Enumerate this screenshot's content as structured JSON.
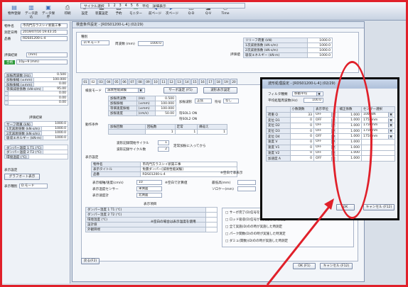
{
  "ribbon": {
    "buttons": [
      {
        "label": "物件登録",
        "icon": "folder-icon",
        "color": "#3a6db8"
      },
      {
        "label": "データ読込",
        "icon": "open-file-icon",
        "color": "#3a6db8"
      },
      {
        "label": "データ保存",
        "icon": "save-icon",
        "color": "#3a6db8"
      },
      {
        "label": "印刷",
        "icon": "print-icon",
        "color": "#555555"
      },
      {
        "label": "設定",
        "icon": "settings-icon",
        "color": "#555555"
      },
      {
        "label": "装置設定",
        "icon": "device-icon",
        "color": "#555555"
      },
      {
        "label": "予約",
        "icon": "calendar-icon",
        "color": "#555555"
      },
      {
        "label": "モニター",
        "icon": "monitor-icon",
        "color": "#2b8a3e"
      },
      {
        "label": "前ページ",
        "icon": "back-arrow-icon",
        "color": "#2456b0"
      },
      {
        "label": "次ページ",
        "icon": "forward-arrow-icon",
        "color": "#2456b0"
      },
      {
        "label": "Q-D",
        "icon": "qd-icon",
        "color": "#555555"
      },
      {
        "label": "Q-V",
        "icon": "qv-icon",
        "color": "#555555"
      },
      {
        "label": "Time",
        "icon": "time-icon",
        "color": "#555555"
      }
    ],
    "toolbar": [
      "サイクル選択",
      "1",
      "2",
      "3",
      "4",
      "5",
      "6",
      "平均",
      "詳細表示"
    ]
  },
  "left": {
    "rows": [
      {
        "label": "物件名",
        "value": "市内門方ラスシイ新築工事"
      },
      {
        "label": "測定日時",
        "value": "2019/07/16 19:43:35"
      },
      {
        "label": "品番",
        "value": "RDS01200-L-4"
      }
    ],
    "judge_label": "評価結果",
    "judge_badge": "合格",
    "spec_rows": [
      {
        "label": "評価結果",
        "value": "(mm)",
        "extra": ""
      },
      {
        "label": "加振状態",
        "value": "10μ~9 (mm)",
        "extra": ""
      }
    ],
    "table1": [
      [
        "加振周波数 (Hz)",
        "0.500"
      ],
      [
        "加振振幅 (±mm)",
        "100.000"
      ],
      [
        "加振振幅 (±mm)",
        "0.00"
      ],
      [
        "等価減衰係数 (kN·s/m)",
        "95.00"
      ],
      [
        "",
        "0.00"
      ],
      [
        "",
        "0.00"
      ],
      [
        "",
        "0.00"
      ]
    ],
    "section2_title": "評価結果",
    "table2": [
      [
        "サーフ荷重 (kN)",
        "1000.0"
      ],
      [
        "1次減衰係数 (kN·s/m)",
        "1000.0"
      ],
      [
        "2次減衰係数 (kN·s/m)",
        "1000.0"
      ],
      [
        "吸収エネルギー (kN·m)",
        "1000.0"
      ]
    ],
    "table3": [
      [
        "ダンパー温度 1 T1 (℃)",
        ""
      ],
      [
        "ダンパー温度 2 T2 (℃)",
        ""
      ],
      [
        "環境温度 (℃)",
        ""
      ]
    ],
    "mode_label": "表示設定",
    "mode_button": "グラフオート表示",
    "speed_label": "表示種別",
    "speed_value": "D.モード"
  },
  "main": {
    "title": "検査条件設定 - [RDS01200-L-4] (02/29)",
    "type_label": "種別",
    "type_value": "Ｄ/Ｋモード",
    "freq_label": "周波数 (mm)",
    "freq_value": "1000.0",
    "eval_label": "評価値",
    "eval_rows": [
      [
        "リリーフ荷重 (kN)",
        "1000.0"
      ],
      [
        "1次減衰係数 (kN·s/m)",
        "1000.0"
      ],
      [
        "2次減衰係数 (kN·s/m)",
        "1000.0"
      ],
      [
        "吸収エネルギー (kN·m)",
        "1000.0"
      ]
    ],
    "tabs": [
      "01",
      "02",
      "03",
      "04",
      "05",
      "06",
      "07",
      "08",
      "09",
      "10",
      "11",
      "12",
      "13",
      "14",
      "15",
      "16",
      "17",
      "18",
      "19",
      "20"
    ],
    "mode_label": "検査モード",
    "mode_value": "減衰性能試験",
    "servo_btn": "サーボ設定 (F5)",
    "sensor_btn": "波形表示設定",
    "cond_label": "動作条件",
    "cond_rows": [
      [
        "加振周波数",
        "(Hz)",
        "0.500"
      ],
      [
        "加振振幅",
        "(±mm)",
        "100.000"
      ],
      [
        "等価速度振幅",
        "(±mm)",
        "100.000"
      ],
      [
        "加振速度",
        "(cm/s)",
        "50.00"
      ]
    ],
    "wave_label": "加振波形",
    "wave_value": "正弦",
    "sign_label": "符号",
    "sign_value": "なし",
    "check1": "符SOL1 ON",
    "check2": "符SOL2 ON",
    "count_hdr": [
      "加振回数",
      "回転数",
      "定常",
      "繰返え"
    ],
    "count_vals": [
      "1",
      "1",
      "1"
    ],
    "rec_label1": "波形記録開始サイクル",
    "rec_val1": "1",
    "rec_label2": "波形記録サイクル数",
    "rec_val2": "2",
    "check3": "定常加振に入ってから",
    "disp_label": "表示設定",
    "disp_rows": [
      [
        "物件名",
        "市内門方ラスシイ新築工事"
      ],
      [
        "表示タイトル",
        "免震ダンパー[減衰性能試験]"
      ],
      [
        "品番",
        "RDS01200-L-4"
      ]
    ],
    "disp_row4_label": "表示縦軸/速度(cm/s)",
    "disp_row4_val": "10",
    "disp_row4_note": "※空白で計算値",
    "disp_row5_label": "表示温度センサー",
    "disp_row5_val": "東側面",
    "disp_row6_label": "表示速度計",
    "disp_row6_val": "北側面",
    "disp_extra1": "※空白で非表示",
    "disp_extra2": "最低高(mm)",
    "disp_extra3": "ソロケー(mm)",
    "table_title": "表示項目",
    "table_rows": [
      "ダンパー温度 1 T1 (℃)",
      "ダンパー温度 2 T2 (℃)",
      "環境温度 (℃)",
      "設計値",
      "外観目視"
    ],
    "table_note": "※空白の場合は表示温度を使用",
    "right_items": [
      "サーボ完了(D)信号を実施した時測定",
      "ロッド吸収(D)信号が未実施した時測定",
      "全て実施(D)のの時が実施した時測定",
      "パーク関数(D)のの時が実施した時測定",
      "ダミュ(関数)(D)のの時が実施した時測定"
    ],
    "ok_btn": "OK (F1)",
    "cancel_btn": "キャンセル (F12)",
    "bottom_btn": "戻る(F2)"
  },
  "dialog": {
    "title": "波形処理設定 - [RDS01200-L-4] (02/29)",
    "filter_label": "フィルタ種類",
    "filter_value": "移動平均",
    "freq_label": "平均処理周波数(Hz)",
    "freq_value": "100.0",
    "headers": [
      "",
      "小数期数",
      "表示単位",
      "補正係数",
      "センサー選択"
    ],
    "rows": [
      [
        "荷重 Q",
        "33",
        "OFF",
        "1.000",
        "1000kN"
      ],
      [
        "変位 D1",
        "0",
        "OFF",
        "1.000",
        "1750mm"
      ],
      [
        "変位 D2",
        "0",
        "OFF",
        "1.000",
        "1750mm"
      ],
      [
        "変位 D3",
        "0",
        "OFF",
        "1.000",
        "1750mm"
      ],
      [
        "変位 D4",
        "0",
        "OFF",
        "1.000",
        "1750mm"
      ],
      [
        "速度 V",
        "0",
        "OFF",
        "1.000",
        ""
      ],
      [
        "速度 V1",
        "0",
        "OFF",
        "1.000",
        ""
      ],
      [
        "速度 V2",
        "0",
        "OFF",
        "1.000",
        ""
      ],
      [
        "加速度 A",
        "0",
        "OFF",
        "1.000",
        ""
      ]
    ],
    "ok_btn": "OK",
    "cancel_btn": "キャンセル (F12)"
  },
  "colors": {
    "annotation": "#e0202a",
    "dialog_border": "#0b0b0b",
    "badge": "#2e9a3a"
  }
}
